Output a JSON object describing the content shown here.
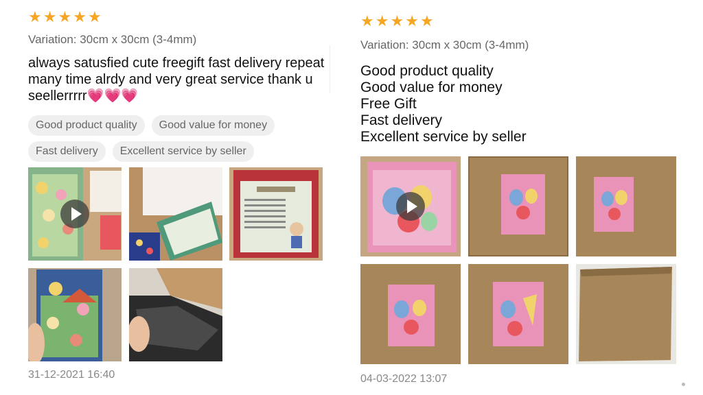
{
  "reviews": [
    {
      "stars": [
        "★",
        "★",
        "★",
        "★",
        "★"
      ],
      "variation": "Variation: 30cm x 30cm (3-4mm)",
      "text": "always satusfied cute freegift fast delivery repeat many time alrdy and very great service thank u seellerrrrr💗💗💗",
      "tags": [
        "Good product quality",
        "Good value for money",
        "Fast delivery",
        "Excellent service by seller"
      ],
      "photos": [
        {
          "desc": "sticker sheet video",
          "video": true
        },
        {
          "desc": "sticker pack on desk",
          "video": false
        },
        {
          "desc": "momoyo craft card",
          "video": false
        },
        {
          "desc": "sticker sheet in hand",
          "video": false
        },
        {
          "desc": "black plastic wrap",
          "video": false
        }
      ],
      "date": "31-12-2021 16:40"
    },
    {
      "stars": [
        "★",
        "★",
        "★",
        "★",
        "★"
      ],
      "variation": "Variation: 30cm x 30cm (3-4mm)",
      "lines": [
        "Good product quality",
        "Good value for money",
        "Free Gift",
        "Fast delivery",
        "Excellent service by seller"
      ],
      "photos": [
        {
          "desc": "pink item pack video",
          "video": true
        },
        {
          "desc": "pink item on cardboard",
          "video": false
        },
        {
          "desc": "pink item on cardboard",
          "video": false
        },
        {
          "desc": "pink item on cardboard",
          "video": false
        },
        {
          "desc": "pink item on cardboard",
          "video": false
        },
        {
          "desc": "cardboard board",
          "video": false
        }
      ],
      "date": "04-03-2022 13:07"
    }
  ],
  "colors": {
    "star": "#f6a623",
    "tag_bg": "#efefef",
    "cardboard": "#a78759",
    "pink": "#e993b8"
  }
}
